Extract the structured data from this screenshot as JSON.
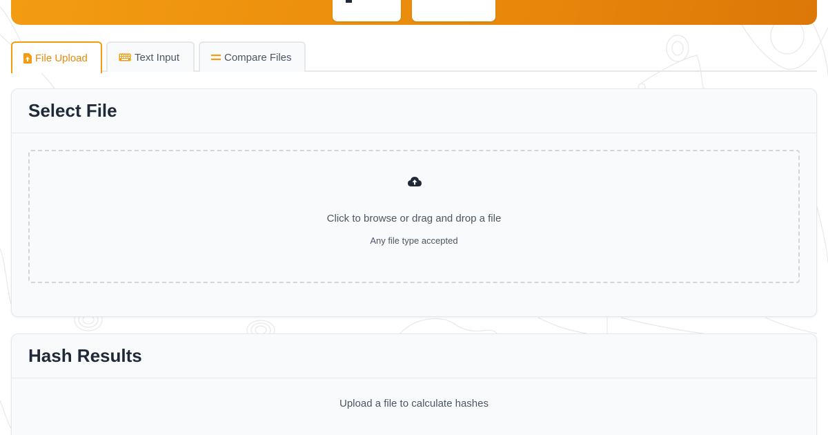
{
  "colors": {
    "accent": "#f39c12",
    "accent_dark": "#db7808",
    "text": "#1f2937",
    "muted": "#4b5563",
    "border": "#e5e7eb"
  },
  "tabs": [
    {
      "label": "File Upload",
      "icon": "file-upload-icon",
      "active": true
    },
    {
      "label": "Text Input",
      "icon": "keyboard-icon",
      "active": false
    },
    {
      "label": "Compare Files",
      "icon": "equals-icon",
      "active": false
    }
  ],
  "select_file": {
    "title": "Select File",
    "dropzone": {
      "icon": "cloud-upload-icon",
      "main_text": "Click to browse or drag and drop a file",
      "sub_text": "Any file type accepted"
    }
  },
  "hash_results": {
    "title": "Hash Results",
    "empty_text": "Upload a file to calculate hashes"
  }
}
